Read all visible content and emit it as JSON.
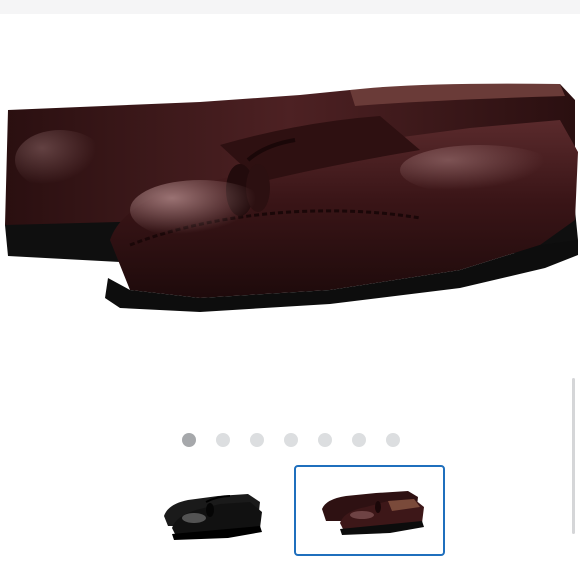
{
  "gallery": {
    "main_image": {
      "icon": "burgundy-tassel-loafer-image"
    },
    "pagination": {
      "total": 7,
      "active_index": 0
    },
    "thumbnails": [
      {
        "icon": "black-loafer-pair-thumbnail",
        "selected": false
      },
      {
        "icon": "burgundy-loafer-pair-thumbnail",
        "selected": true
      }
    ]
  },
  "colors": {
    "selection_border": "#1f6fbd",
    "leather_burgundy": "#3a1517",
    "leather_black": "#141414",
    "dot_active": "#a6a8ab",
    "dot_inactive": "#dcdee0"
  }
}
